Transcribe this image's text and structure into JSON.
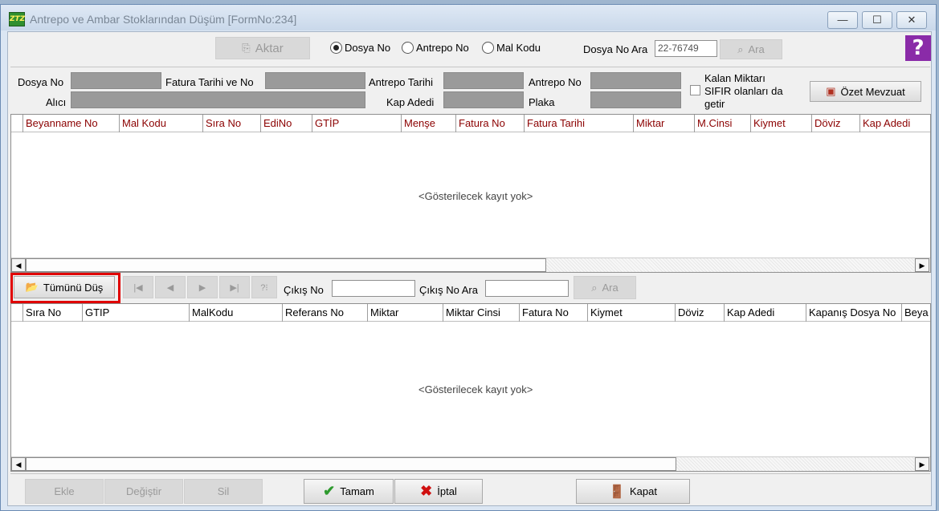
{
  "window": {
    "title": "Antrepo ve Ambar Stoklarından Düşüm [FormNo:234]",
    "controls": {
      "minimize": "—",
      "maximize": "☐",
      "close": "✕"
    }
  },
  "toolbar": {
    "aktar_label": "Aktar",
    "radio_dosya": "Dosya No",
    "radio_antrepo": "Antrepo No",
    "radio_mal": "Mal Kodu",
    "selected_radio": "Dosya No",
    "dosya_ara_label": "Dosya No Ara",
    "dosya_ara_value": "22-76749",
    "ara_label": "Ara",
    "help_glyph": "?"
  },
  "info": {
    "dosya_no_label": "Dosya No",
    "fatura_label": "Fatura Tarihi ve No",
    "antrepo_tarihi_label": "Antrepo Tarihi",
    "antrepo_no_label": "Antrepo No",
    "alici_label": "Alıcı",
    "kap_adedi_label": "Kap Adedi",
    "plaka_label": "Plaka",
    "kalan_miktari_label": "Kalan Miktarı",
    "sifir_label": "SIFIR olanları da",
    "getir_label": "getir",
    "ozet_mevzuat_label": "Özet Mevzuat"
  },
  "grid1": {
    "columns": [
      "Beyanname No",
      "Mal Kodu",
      "Sıra No",
      "EdiNo",
      "GTİP",
      "Menşe",
      "Fatura No",
      "Fatura Tarihi",
      "Miktar",
      "M.Cinsi",
      "Kiymet",
      "Döviz",
      "Kap Adedi"
    ],
    "empty_text": "<Gösterilecek kayıt yok>"
  },
  "midbar": {
    "tumunu_dus_label": "Tümünü Düş",
    "nav_first": "|◀",
    "nav_prev": "◀",
    "nav_next": "▶",
    "nav_last": "▶|",
    "nav_search": "?⁝",
    "cikis_no_label": "Çıkış No",
    "cikis_no_ara_label": "Çıkış No Ara",
    "ara_label": "Ara"
  },
  "grid2": {
    "columns": [
      "Sıra No",
      "GTIP",
      "MalKodu",
      "Referans No",
      "Miktar",
      "Miktar Cinsi",
      "Fatura No",
      "Kiymet",
      "Döviz",
      "Kap Adedi",
      "Kapanış Dosya No",
      "Beya"
    ],
    "empty_text": "<Gösterilecek kayıt yok>"
  },
  "footer": {
    "ekle_label": "Ekle",
    "degistir_label": "Değiştir",
    "sil_label": "Sil",
    "tamam_label": "Tamam",
    "iptal_label": "İptal",
    "kapat_label": "Kapat"
  },
  "colors": {
    "highlight": "#e00000",
    "header_red": "#8b0000",
    "check_green": "#2e9a2e",
    "cancel_red": "#d01010"
  }
}
